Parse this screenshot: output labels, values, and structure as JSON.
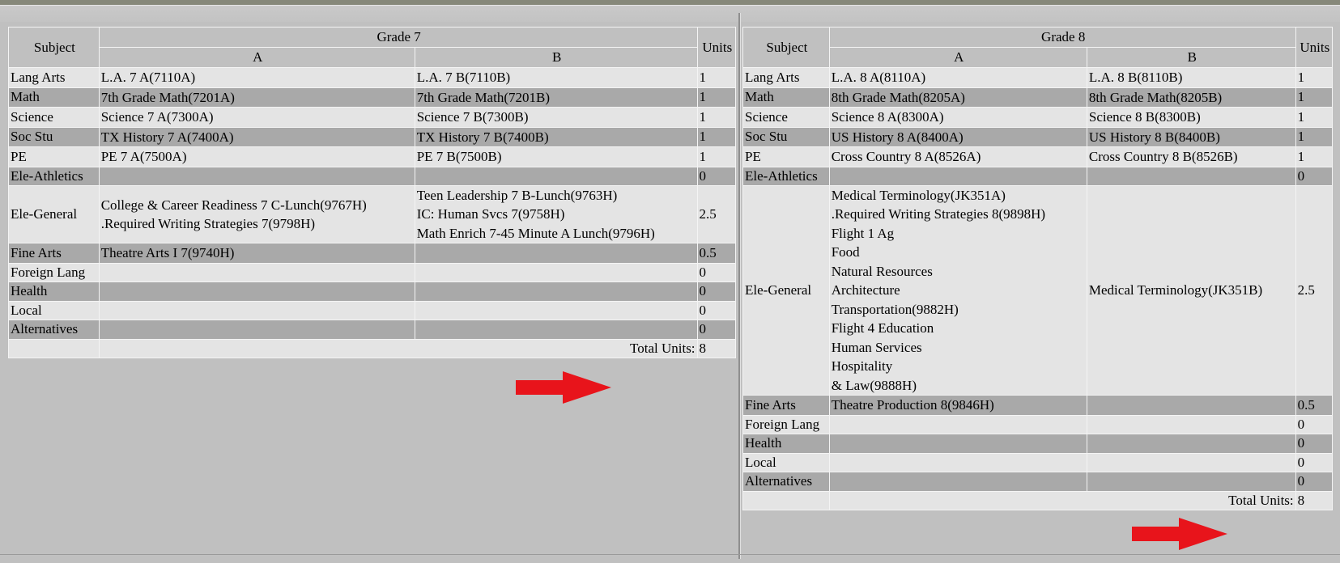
{
  "grade7": {
    "headers": {
      "subject": "Subject",
      "grade": "Grade 7",
      "units": "Units",
      "col_a": "A",
      "col_b": "B"
    },
    "rows": [
      {
        "subject": "Lang Arts",
        "a": [
          "L.A. 7 A(7110A)"
        ],
        "b": [
          "L.A. 7 B(7110B)"
        ],
        "units": "1"
      },
      {
        "subject": "Math",
        "a": [
          "7th Grade Math(7201A)"
        ],
        "b": [
          "7th Grade Math(7201B)"
        ],
        "units": "1"
      },
      {
        "subject": "Science",
        "a": [
          "Science 7 A(7300A)"
        ],
        "b": [
          "Science 7 B(7300B)"
        ],
        "units": "1"
      },
      {
        "subject": "Soc Stu",
        "a": [
          "TX History 7 A(7400A)"
        ],
        "b": [
          "TX History 7 B(7400B)"
        ],
        "units": "1"
      },
      {
        "subject": "PE",
        "a": [
          "PE 7 A(7500A)"
        ],
        "b": [
          "PE 7 B(7500B)"
        ],
        "units": "1"
      },
      {
        "subject": "Ele-Athletics",
        "a": [],
        "b": [],
        "units": "0"
      },
      {
        "subject": "Ele-General",
        "a": [
          "College & Career Readiness 7 C-Lunch(9767H)",
          ".Required Writing Strategies 7(9798H)"
        ],
        "b": [
          "Teen Leadership 7 B-Lunch(9763H)",
          "IC: Human Svcs 7(9758H)",
          "Math Enrich 7-45 Minute A Lunch(9796H)"
        ],
        "units": "2.5"
      },
      {
        "subject": "Fine Arts",
        "a": [
          "Theatre Arts I 7(9740H)"
        ],
        "b": [],
        "units": "0.5"
      },
      {
        "subject": "Foreign Lang",
        "a": [],
        "b": [],
        "units": "0"
      },
      {
        "subject": "Health",
        "a": [],
        "b": [],
        "units": "0"
      },
      {
        "subject": "Local",
        "a": [],
        "b": [],
        "units": "0"
      },
      {
        "subject": "Alternatives",
        "a": [],
        "b": [],
        "units": "0"
      }
    ],
    "total_label": "Total Units:",
    "total_value": "8"
  },
  "grade8": {
    "headers": {
      "subject": "Subject",
      "grade": "Grade 8",
      "units": "Units",
      "col_a": "A",
      "col_b": "B"
    },
    "rows": [
      {
        "subject": "Lang Arts",
        "a": [
          "L.A. 8 A(8110A)"
        ],
        "b": [
          "L.A. 8 B(8110B)"
        ],
        "units": "1"
      },
      {
        "subject": "Math",
        "a": [
          "8th Grade Math(8205A)"
        ],
        "b": [
          "8th Grade Math(8205B)"
        ],
        "units": "1"
      },
      {
        "subject": "Science",
        "a": [
          "Science 8 A(8300A)"
        ],
        "b": [
          "Science 8 B(8300B)"
        ],
        "units": "1"
      },
      {
        "subject": "Soc Stu",
        "a": [
          "US History 8 A(8400A)"
        ],
        "b": [
          "US History 8 B(8400B)"
        ],
        "units": "1"
      },
      {
        "subject": "PE",
        "a": [
          "Cross Country 8 A(8526A)"
        ],
        "b": [
          "Cross Country 8 B(8526B)"
        ],
        "units": "1"
      },
      {
        "subject": "Ele-Athletics",
        "a": [],
        "b": [],
        "units": "0"
      },
      {
        "subject": "Ele-General",
        "a": [
          "Medical Terminology(JK351A)",
          ".Required Writing Strategies 8(9898H)",
          "Flight 1 Ag",
          "Food",
          "Natural Resources",
          "Architecture",
          "Transportation(9882H)",
          "Flight 4 Education",
          "Human Services",
          "Hospitality",
          "& Law(9888H)"
        ],
        "b": [
          "Medical Terminology(JK351B)"
        ],
        "units": "2.5"
      },
      {
        "subject": "Fine Arts",
        "a": [
          "Theatre Production 8(9846H)"
        ],
        "b": [],
        "units": "0.5"
      },
      {
        "subject": "Foreign Lang",
        "a": [],
        "b": [],
        "units": "0"
      },
      {
        "subject": "Health",
        "a": [],
        "b": [],
        "units": "0"
      },
      {
        "subject": "Local",
        "a": [],
        "b": [],
        "units": "0"
      },
      {
        "subject": "Alternatives",
        "a": [],
        "b": [],
        "units": "0"
      }
    ],
    "total_label": "Total Units:",
    "total_value": "8"
  },
  "colors": {
    "arrow": "#e8141b",
    "row_light": "#e4e4e4",
    "row_dark": "#a9a9a9",
    "panel_bg": "#c0c0c0"
  },
  "icons": {
    "annotation": "right-arrow-icon"
  }
}
